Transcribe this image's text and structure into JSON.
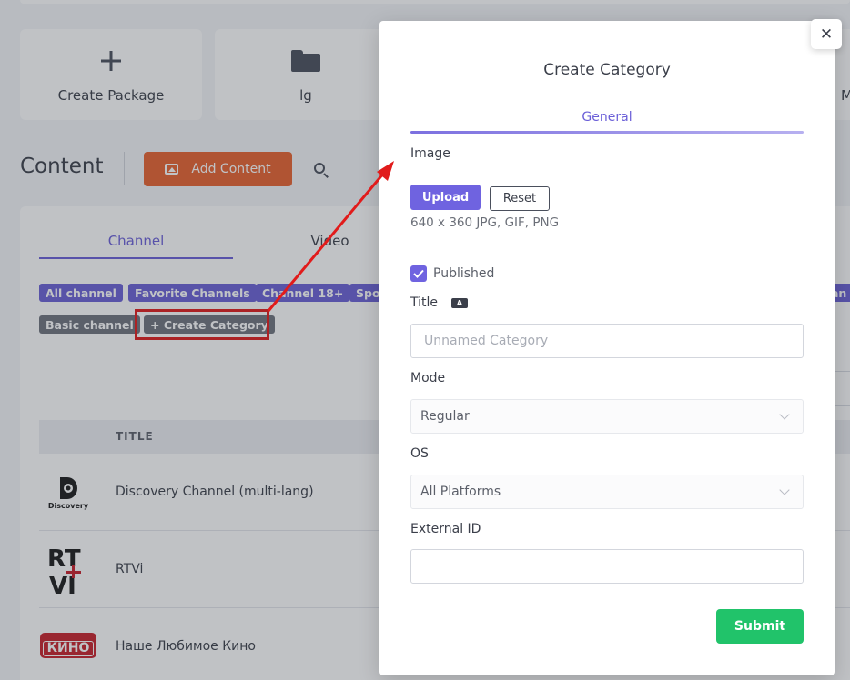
{
  "tiles": [
    {
      "label": "Create Package",
      "icon": "plus-icon"
    },
    {
      "label": "lg",
      "icon": "folder-icon"
    },
    {
      "label": "M",
      "icon": ""
    }
  ],
  "content": {
    "title": "Content",
    "add_button": "Add Content"
  },
  "tabs": [
    "Channel",
    "Video"
  ],
  "chips": {
    "row1": [
      "All channel",
      "Favorite Channels",
      "Channel 18+",
      "Spo",
      "an"
    ],
    "row2": [
      "Basic channel",
      "+ Create Category"
    ]
  },
  "table": {
    "header_title": "TITLE",
    "rows": [
      {
        "name": "Discovery Channel (multi-lang)",
        "logo": "Discovery"
      },
      {
        "name": "RTVi",
        "logo": "RTVI"
      },
      {
        "name": "Наше Любимое Кино",
        "logo": "КИНО"
      }
    ]
  },
  "modal": {
    "title": "Create Category",
    "tab": "General",
    "close_symbol": "✕",
    "image_label": "Image",
    "upload_label": "Upload",
    "reset_label": "Reset",
    "image_hint": "640 x 360 JPG, GIF, PNG",
    "published_label": "Published",
    "published_checked": true,
    "title_label": "Title",
    "title_placeholder": "Unnamed Category",
    "title_value": "",
    "mode_label": "Mode",
    "mode_value": "Regular",
    "os_label": "OS",
    "os_value": "All Platforms",
    "external_id_label": "External ID",
    "external_id_value": "",
    "submit_label": "Submit"
  },
  "colors": {
    "accent": "#6f63e0",
    "orange": "#e8622f",
    "submit": "#21c36a",
    "annotation": "#e11b1b"
  }
}
